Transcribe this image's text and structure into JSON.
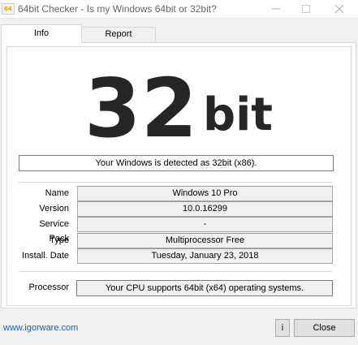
{
  "window": {
    "title": "64bit Checker - Is my Windows 64bit or 32bit?",
    "app_icon_text": "64"
  },
  "tabs": [
    {
      "label": "Info",
      "active": true
    },
    {
      "label": "Report",
      "active": false
    }
  ],
  "result": {
    "number": "32",
    "unit": "bit",
    "detected_text": "Your Windows is detected as 32bit (x86)."
  },
  "details": [
    {
      "label": "Name",
      "value": "Windows 10 Pro"
    },
    {
      "label": "Version",
      "value": "10.0.16299"
    },
    {
      "label": "Service Pack",
      "value": "-"
    },
    {
      "label": "Type",
      "value": "Multiprocessor Free"
    },
    {
      "label": "Install. Date",
      "value": "Tuesday, January 23, 2018"
    }
  ],
  "processor": {
    "label": "Processor",
    "value": "Your CPU supports 64bit (x64) operating systems."
  },
  "footer": {
    "link": "www.igorware.com",
    "info_button": "i",
    "close_button": "Close"
  },
  "colors": {
    "link": "#1e60b8",
    "big_text": "#262626",
    "background": "#f0f0f0"
  }
}
